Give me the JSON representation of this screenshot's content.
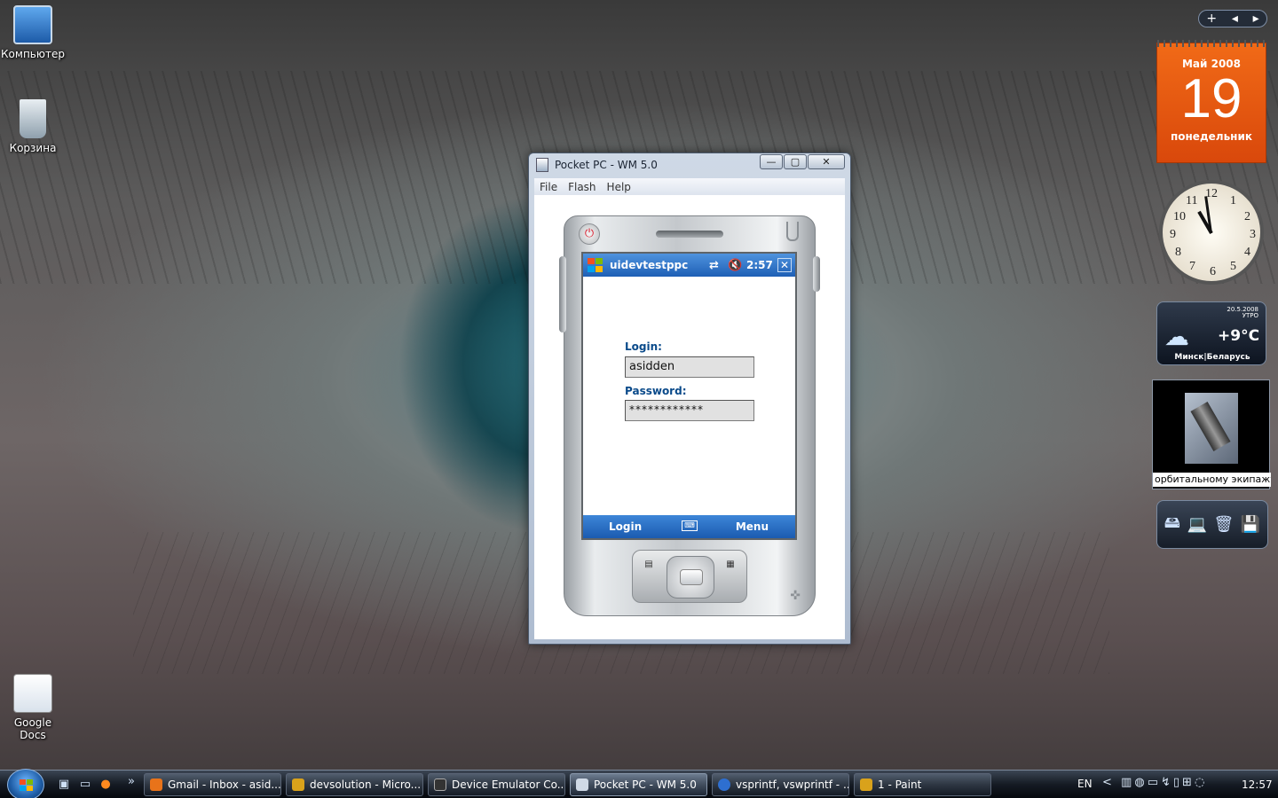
{
  "desktop": {
    "icons": [
      {
        "label": "Компьютер",
        "icon": "computer-icon"
      },
      {
        "label": "Корзина",
        "icon": "recycle-bin-icon"
      },
      {
        "label": "Google Docs",
        "icon": "google-docs-icon"
      }
    ]
  },
  "emulator_window": {
    "title": "Pocket PC - WM 5.0",
    "menu": [
      "File",
      "Flash",
      "Help"
    ],
    "controls": {
      "minimize": "—",
      "maximize": "▢",
      "close": "✕"
    }
  },
  "device": {
    "status_bar": {
      "app_name": "uidevtestppc",
      "time": "2:57",
      "sync_icon": "⇄",
      "volume_icon": "🔇",
      "close_label": "✕"
    },
    "form": {
      "login_label": "Login:",
      "login_value": "asidden",
      "password_label": "Password:",
      "password_value": "************"
    },
    "softkeys": {
      "left": "Login",
      "right": "Menu",
      "keyboard_icon": "⌨"
    }
  },
  "sidebar": {
    "controls": {
      "add": "+",
      "prev": "◂",
      "next": "▸"
    },
    "calendar": {
      "month": "Май 2008",
      "day": "19",
      "weekday": "понедельник"
    },
    "clock": {
      "numbers": [
        "12",
        "1",
        "2",
        "3",
        "4",
        "5",
        "6",
        "7",
        "8",
        "9",
        "10",
        "11"
      ]
    },
    "weather": {
      "date": "20.5.2008",
      "period": "УТРО",
      "temp": "+9°C",
      "location": "Минск|Беларусь"
    },
    "slideshow": {
      "caption": "орбитальному экипажу бо"
    },
    "drives": {
      "icons": [
        "🖴",
        "💻",
        "🗑",
        "💾"
      ]
    }
  },
  "taskbar": {
    "quicklaunch_more": "»",
    "items": [
      {
        "label": "Gmail - Inbox - asid...",
        "color": "#e8731a"
      },
      {
        "label": "devsolution - Micro...",
        "color": "#d9a21b"
      },
      {
        "label": "Device Emulator Co...",
        "color": "#333333"
      },
      {
        "label": "Pocket PC - WM 5.0",
        "color": "#cfd9e6"
      },
      {
        "label": "vsprintf, vswprintf - ...",
        "color": "#2e6fd0"
      },
      {
        "label": "1 - Paint",
        "color": "#d9a21b"
      }
    ],
    "language": "EN",
    "tray_expand": "<",
    "time": "12:57"
  }
}
